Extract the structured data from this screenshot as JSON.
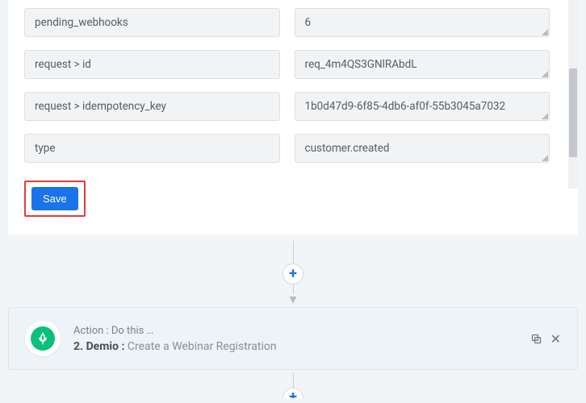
{
  "fields": [
    {
      "key": "pending_webhooks",
      "value": "6"
    },
    {
      "key": "request > id",
      "value": "req_4m4QS3GNlRAbdL"
    },
    {
      "key": "request > idempotency_key",
      "value": "1b0d47d9-6f85-4db6-af0f-55b3045a7032"
    },
    {
      "key": "type",
      "value": "customer.created"
    }
  ],
  "save_label": "Save",
  "plus_glyph": "+",
  "arrow_glyph": "▾",
  "step": {
    "prefix": "Action : Do this …",
    "number": "2.",
    "app": "Demio :",
    "desc": "Create a Webinar Registration"
  },
  "close_glyph": "✕"
}
